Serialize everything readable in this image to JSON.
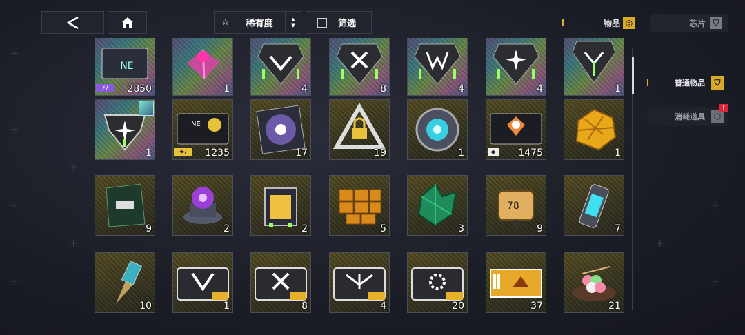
{
  "topbar": {
    "back_icon": "back-arrow-icon",
    "home_icon": "home-icon",
    "sort_label": "稀有度",
    "sort_icon": "star-icon",
    "filter_label": "筛选",
    "filter_icon": "filter-icon"
  },
  "tabs": [
    {
      "label": "物品",
      "active": true,
      "icon": "items-icon"
    },
    {
      "label": "芯片",
      "active": false,
      "icon": "chip-icon"
    }
  ],
  "sidebar": [
    {
      "label": "普通物品",
      "active": true,
      "icon": "normal-items-icon"
    },
    {
      "label": "消耗道具",
      "active": false,
      "icon": "consumables-icon",
      "badge": "!"
    }
  ],
  "colors": {
    "accent": "#d9a92a",
    "badge": "#e0223a",
    "tag_purple": "#8a5ad8",
    "tag_yellow": "#e8c23a"
  },
  "items": [
    {
      "count": "2850",
      "bg": "holo",
      "icon": "card-pack-icon",
      "tag": "purple",
      "tag_text": "⚡/"
    },
    {
      "count": "1",
      "bg": "holo",
      "icon": "gift-box-icon"
    },
    {
      "count": "4",
      "bg": "holo",
      "icon": "badge-v-icon"
    },
    {
      "count": "8",
      "bg": "holo",
      "icon": "badge-x-icon"
    },
    {
      "count": "4",
      "bg": "holo",
      "icon": "badge-w-icon"
    },
    {
      "count": "4",
      "bg": "holo",
      "icon": "badge-star-icon"
    },
    {
      "count": "1",
      "bg": "holo",
      "icon": "badge-shield-icon"
    },
    {
      "count": "1",
      "bg": "holo",
      "icon": "shield-emblem-icon",
      "mini": true
    },
    {
      "count": "1235",
      "bg": "gold",
      "icon": "ticket-card-icon",
      "tag": "yellow",
      "tag_text": "★/"
    },
    {
      "count": "17",
      "bg": "gold",
      "icon": "record-disc-icon"
    },
    {
      "count": "19",
      "bg": "gold",
      "icon": "locked-triangle-icon"
    },
    {
      "count": "1",
      "bg": "gold",
      "icon": "core-disc-icon"
    },
    {
      "count": "1475",
      "bg": "gold",
      "icon": "coin-card-icon",
      "tag": "white",
      "tag_text": "◆"
    },
    {
      "count": "1",
      "bg": "gold",
      "icon": "gold-cluster-icon"
    },
    {
      "count": "9",
      "bg": "gold",
      "icon": "green-pack-icon"
    },
    {
      "count": "2",
      "bg": "gold",
      "icon": "purple-orb-icon"
    },
    {
      "count": "2",
      "bg": "gold",
      "icon": "lantern-icon"
    },
    {
      "count": "5",
      "bg": "gold",
      "icon": "gold-bricks-icon"
    },
    {
      "count": "3",
      "bg": "gold",
      "icon": "green-crystal-icon"
    },
    {
      "count": "9",
      "bg": "gold",
      "icon": "chip-78-icon"
    },
    {
      "count": "7",
      "bg": "gold",
      "icon": "energy-cell-icon"
    },
    {
      "count": "10",
      "bg": "gold",
      "icon": "drill-bit-icon"
    },
    {
      "count": "1",
      "bg": "gold",
      "icon": "card-v-icon"
    },
    {
      "count": "8",
      "bg": "gold",
      "icon": "card-x-icon"
    },
    {
      "count": "4",
      "bg": "gold",
      "icon": "card-wings-icon"
    },
    {
      "count": "20",
      "bg": "gold",
      "icon": "card-gear-icon"
    },
    {
      "count": "37",
      "bg": "gold",
      "icon": "gold-ticket-icon"
    },
    {
      "count": "21",
      "bg": "gold",
      "icon": "dango-plate-icon"
    }
  ]
}
